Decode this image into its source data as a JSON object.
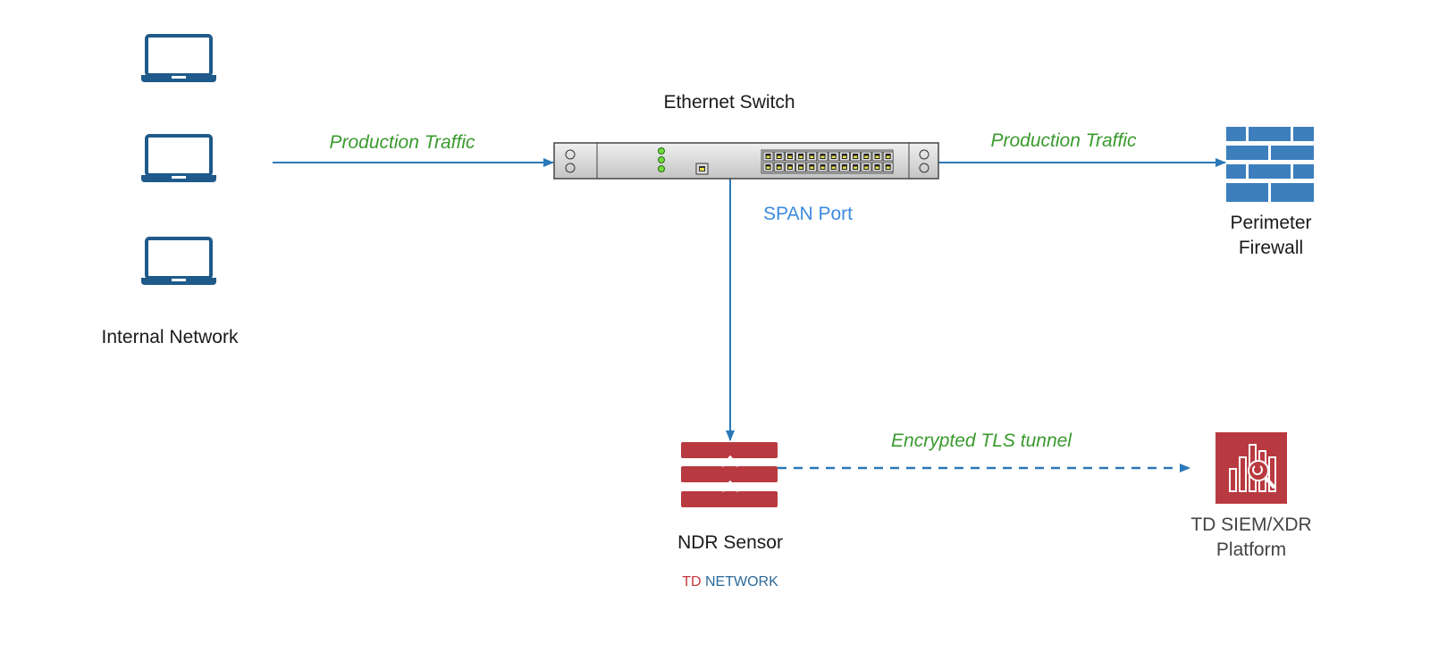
{
  "nodes": {
    "internal_network": {
      "label": "Internal Network",
      "icon": "laptop-icon",
      "count": 3
    },
    "switch": {
      "label": "Ethernet Switch",
      "icon": "ethernet-switch-icon"
    },
    "firewall": {
      "label_line1": "Perimeter",
      "label_line2": "Firewall",
      "icon": "firewall-icon"
    },
    "ndr": {
      "label": "NDR Sensor",
      "brand_td": "TD",
      "brand_network": "NETWORK",
      "icon": "ndr-sensor-icon"
    },
    "siem": {
      "label_line1": "TD SIEM/XDR",
      "label_line2": "Platform",
      "icon": "siem-analytics-icon"
    }
  },
  "edges": {
    "internal_to_switch": "Production Traffic",
    "switch_to_firewall": "Production Traffic",
    "span": "SPAN Port",
    "tls": "Encrypted TLS tunnel"
  },
  "colors": {
    "laptop": "#1f5a8a",
    "arrow": "#2b78b8",
    "edge_label": "#3a9a2e",
    "span_label": "#3c8ae0",
    "firewall": "#3d7fbd",
    "ndr": "#b83a40",
    "brand_td": "#c8363c",
    "brand_network": "#2d6a9a"
  }
}
